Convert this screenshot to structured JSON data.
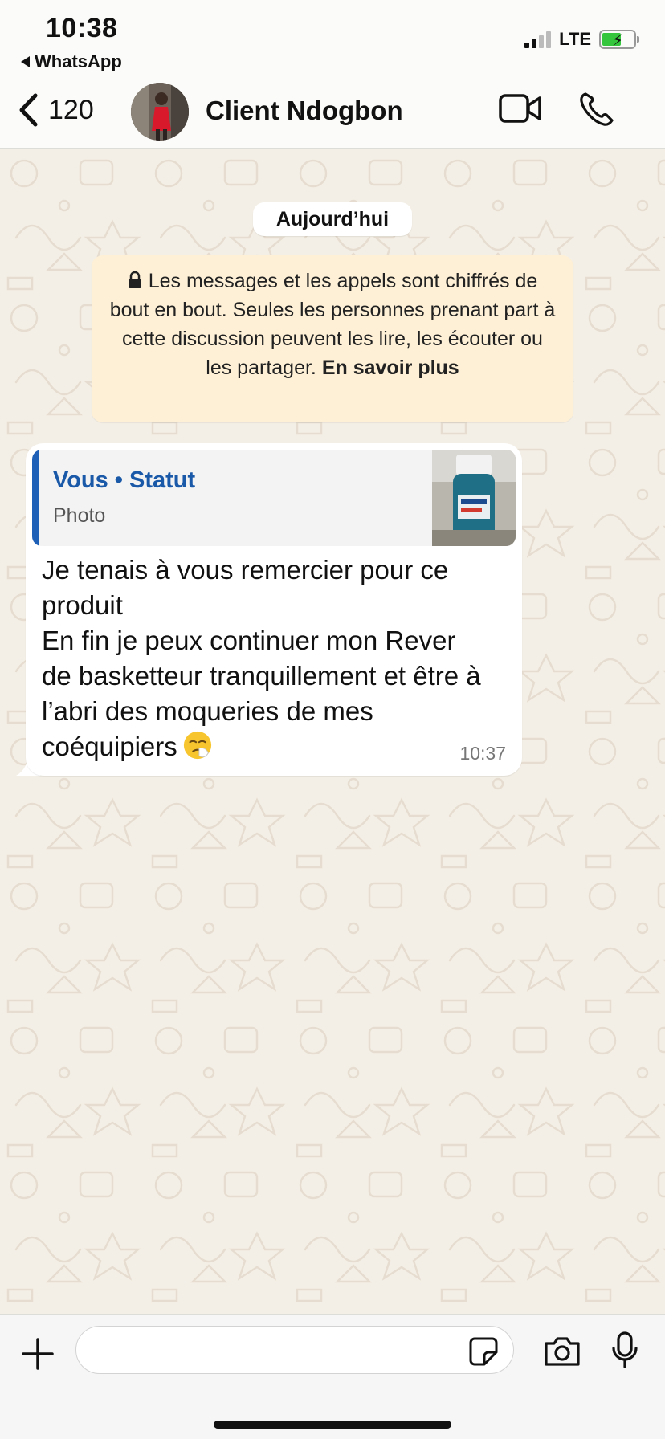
{
  "status_bar": {
    "time": "10:38",
    "back_app": "WhatsApp",
    "network": "LTE"
  },
  "header": {
    "unread_count": "120",
    "contact_name": "Client Ndogbon",
    "icons": [
      "chevron-left-icon",
      "video-camera-icon",
      "phone-icon"
    ]
  },
  "chat": {
    "date_label": "Aujourd’hui",
    "encryption_note": {
      "text": "Les messages et les appels sont chiffrés de bout en bout. Seules les personnes prenant part à cette discussion peuvent les lire, les écouter ou les partager.",
      "link": "En savoir plus"
    },
    "messages": [
      {
        "quote": {
          "author": "Vous • Statut",
          "type": "Photo"
        },
        "text": "Je tenais à vous remercier pour ce produit\nEn fin je peux continuer mon Rever de basketteur tranquillement et être à l’abri des moqueries de mes coéquipiers",
        "emoji": "sneezing-face",
        "time": "10:37"
      }
    ]
  },
  "composer": {
    "placeholder": "",
    "icons": [
      "plus-icon",
      "sticker-icon",
      "camera-icon",
      "microphone-icon"
    ]
  },
  "colors": {
    "chat_background": "#f4efe6",
    "quote_accent": "#1e5fb8",
    "encryption_bg": "#fdf0d6",
    "battery": "#36c63d"
  }
}
